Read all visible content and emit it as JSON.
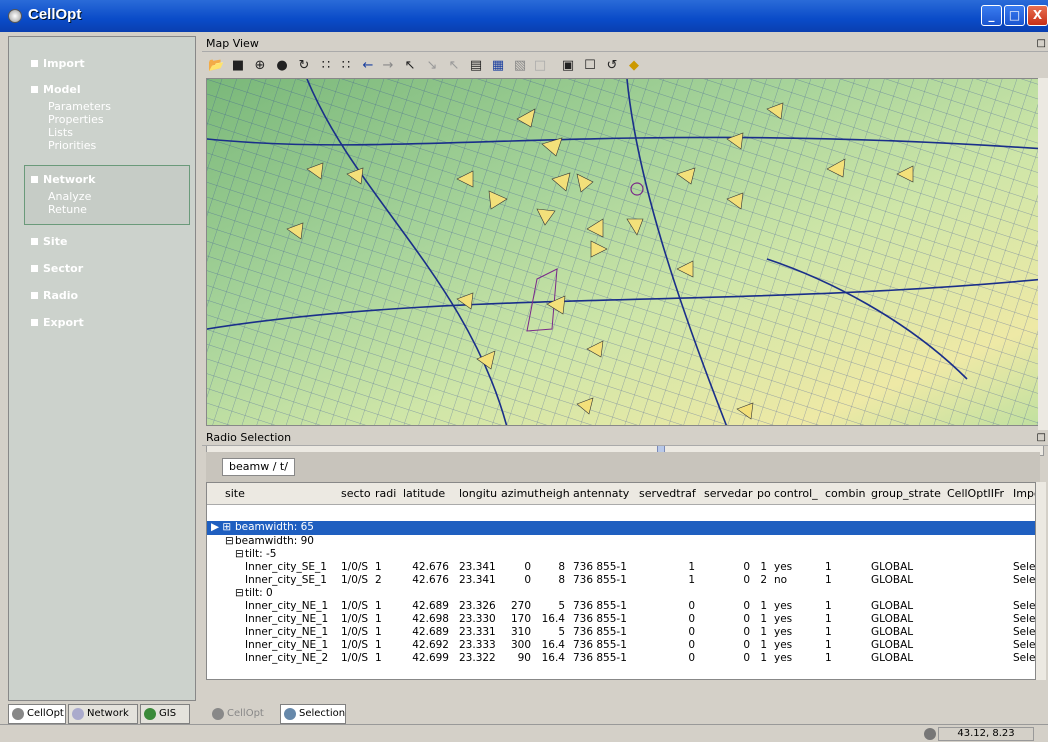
{
  "window": {
    "title": "CellOpt",
    "minimize": "_",
    "maximize": "□",
    "close": "X"
  },
  "nav": {
    "import": "Import",
    "model": "Model",
    "model_sub": [
      "Parameters",
      "Properties",
      "Lists",
      "Priorities"
    ],
    "network": "Network",
    "network_sub": [
      "Analyze",
      "Retune"
    ],
    "site": "Site",
    "sector": "Sector",
    "radio": "Radio",
    "export": "Export"
  },
  "left_tabs": [
    "CellOpt",
    "Network",
    "GIS"
  ],
  "map_view": {
    "title": "Map View",
    "close": "□"
  },
  "radio_selection": {
    "title": "Radio Selection",
    "close": "□",
    "group_tab": "beamw",
    "group_tab_sub": "t/"
  },
  "columns": [
    "site",
    "secto",
    "radi",
    "latitude",
    "longitu",
    "azimut",
    "heigh",
    "antennaty",
    "servedtraf",
    "servedar",
    "po",
    "control_",
    "combin",
    "group_strate",
    "CellOptIIFr",
    "Impo"
  ],
  "groups": {
    "g1": "beamwidth: 65",
    "g2": "beamwidth: 90",
    "t1": "tilt: -5",
    "t2": "tilt: 0"
  },
  "rows_tilt_m5": [
    [
      "Inner_city_SE_1",
      "1/0/S",
      "1",
      "42.676",
      "23.341",
      "0",
      "8",
      "736 855-1",
      "1",
      "0",
      "1",
      "yes",
      "1",
      "GLOBAL",
      "",
      "Select"
    ],
    [
      "Inner_city_SE_1",
      "1/0/S",
      "2",
      "42.676",
      "23.341",
      "0",
      "8",
      "736 855-1",
      "1",
      "0",
      "2",
      "no",
      "1",
      "GLOBAL",
      "",
      "Select"
    ]
  ],
  "rows_tilt_0": [
    [
      "Inner_city_NE_1",
      "1/0/S",
      "1",
      "42.689",
      "23.326",
      "270",
      "5",
      "736 855-1",
      "0",
      "0",
      "1",
      "yes",
      "1",
      "GLOBAL",
      "",
      "Select"
    ],
    [
      "Inner_city_NE_1",
      "1/0/S",
      "1",
      "42.698",
      "23.330",
      "170",
      "16.4",
      "736 855-1",
      "0",
      "0",
      "1",
      "yes",
      "1",
      "GLOBAL",
      "",
      "Select"
    ],
    [
      "Inner_city_NE_1",
      "1/0/S",
      "1",
      "42.689",
      "23.331",
      "310",
      "5",
      "736 855-1",
      "0",
      "0",
      "1",
      "yes",
      "1",
      "GLOBAL",
      "",
      "Select"
    ],
    [
      "Inner_city_NE_1",
      "1/0/S",
      "1",
      "42.692",
      "23.333",
      "300",
      "16.4",
      "736 855-1",
      "0",
      "0",
      "1",
      "yes",
      "1",
      "GLOBAL",
      "",
      "Select"
    ],
    [
      "Inner_city_NE_2",
      "1/0/S",
      "1",
      "42.699",
      "23.322",
      "90",
      "16.4",
      "736 855-1",
      "0",
      "0",
      "1",
      "yes",
      "1",
      "GLOBAL",
      "",
      "Select"
    ]
  ],
  "bottom_tabs": {
    "cellopt": "CellOpt",
    "selection": "Selection"
  },
  "status": {
    "coords": "43.12, 8.23"
  },
  "colors": {
    "titlebar": "#0a4bc8",
    "nav_bg": "#ccd2cc",
    "selected_row": "#1f5fc0",
    "map_green": "#7fbf7f",
    "map_yellow": "#f0e68c"
  }
}
